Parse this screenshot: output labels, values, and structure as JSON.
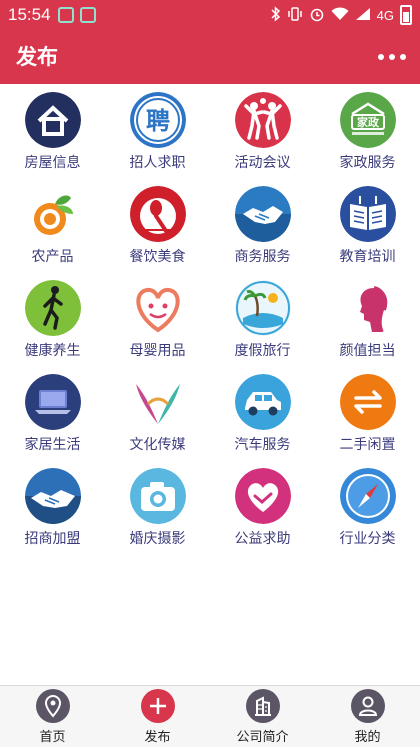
{
  "status_bar": {
    "time": "15:54",
    "network": "4G",
    "icons": [
      "wechat-notification-icon",
      "scan-notification-icon",
      "bluetooth-icon",
      "vibrate-icon",
      "alarm-icon",
      "wifi-icon",
      "signal-icon",
      "battery-icon"
    ]
  },
  "header": {
    "title": "发布",
    "menu_icon": "more-dots-icon",
    "color": "#d7364c"
  },
  "categories": [
    {
      "label": "房屋信息",
      "icon": "house-icon",
      "color": "#232f5e"
    },
    {
      "label": "招人求职",
      "icon": "recruit-icon",
      "color": "#2b74c6"
    },
    {
      "label": "活动会议",
      "icon": "activity-icon",
      "color": "#d8334a"
    },
    {
      "label": "家政服务",
      "icon": "housekeeping-icon",
      "color": "#5aa74a"
    },
    {
      "label": "农产品",
      "icon": "produce-icon",
      "color": "#f08a1c"
    },
    {
      "label": "餐饮美食",
      "icon": "dining-icon",
      "color": "#cf1f2a"
    },
    {
      "label": "商务服务",
      "icon": "handshake-icon",
      "color": "#2b7bc2"
    },
    {
      "label": "教育培训",
      "icon": "book-icon",
      "color": "#2a4f9e"
    },
    {
      "label": "健康养生",
      "icon": "walking-icon",
      "color": "#7fc03a"
    },
    {
      "label": "母婴用品",
      "icon": "mother-baby-icon",
      "color": "#ec7b5f"
    },
    {
      "label": "度假旅行",
      "icon": "island-icon",
      "color": "#38a6d8"
    },
    {
      "label": "颜值担当",
      "icon": "beauty-icon",
      "color": "#c8336c"
    },
    {
      "label": "家居生活",
      "icon": "laptop-icon",
      "color": "#2c3f7d"
    },
    {
      "label": "文化传媒",
      "icon": "culture-icon",
      "color": "#c44a8e"
    },
    {
      "label": "汽车服务",
      "icon": "car-icon",
      "color": "#3aa3dc"
    },
    {
      "label": "二手闲置",
      "icon": "exchange-icon",
      "color": "#f07a12"
    },
    {
      "label": "招商加盟",
      "icon": "partnership-icon",
      "color": "#2d70b8"
    },
    {
      "label": "婚庆摄影",
      "icon": "camera-icon",
      "color": "#5ab8e0"
    },
    {
      "label": "公益求助",
      "icon": "charity-heart-icon",
      "color": "#d2327d"
    },
    {
      "label": "行业分类",
      "icon": "compass-icon",
      "color": "#3588d8"
    }
  ],
  "tabbar": [
    {
      "label": "首页",
      "icon": "location-pin-icon",
      "active": false
    },
    {
      "label": "发布",
      "icon": "plus-icon",
      "active": true
    },
    {
      "label": "公司简介",
      "icon": "building-icon",
      "active": false
    },
    {
      "label": "我的",
      "icon": "user-icon",
      "active": false
    }
  ],
  "colors": {
    "accent": "#d7364c",
    "label_text": "#3b3b7c",
    "tab_icon_bg": "#5b5566"
  }
}
